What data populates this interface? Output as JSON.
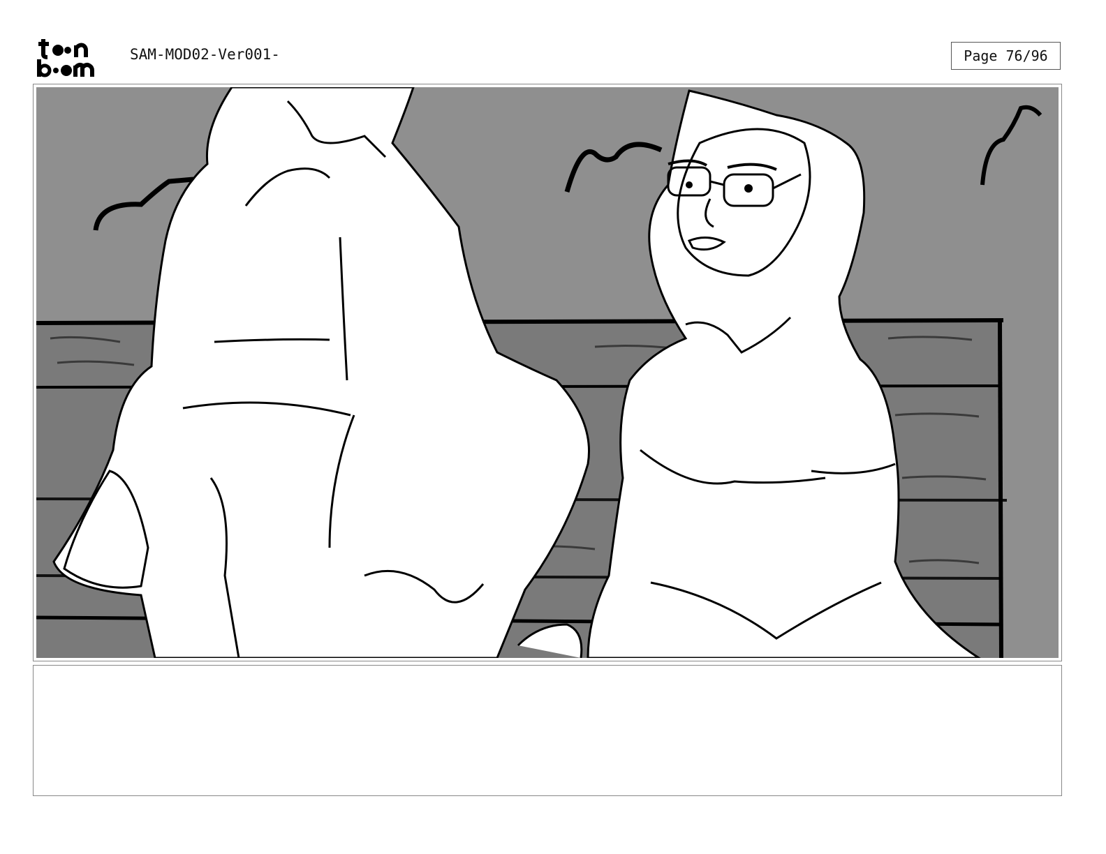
{
  "header": {
    "logo_text": [
      "toon",
      "boom"
    ],
    "document_title": "SAM-MOD02-Ver001-",
    "page_label": "Page 76/96"
  },
  "panel": {
    "scene": "storyboard-sketch",
    "colors": {
      "background_gray": "#8f8f8f",
      "bench_gray": "#7a7a7a",
      "line": "#000000",
      "figure_fill": "#ffffff"
    }
  },
  "caption": {
    "text": ""
  }
}
